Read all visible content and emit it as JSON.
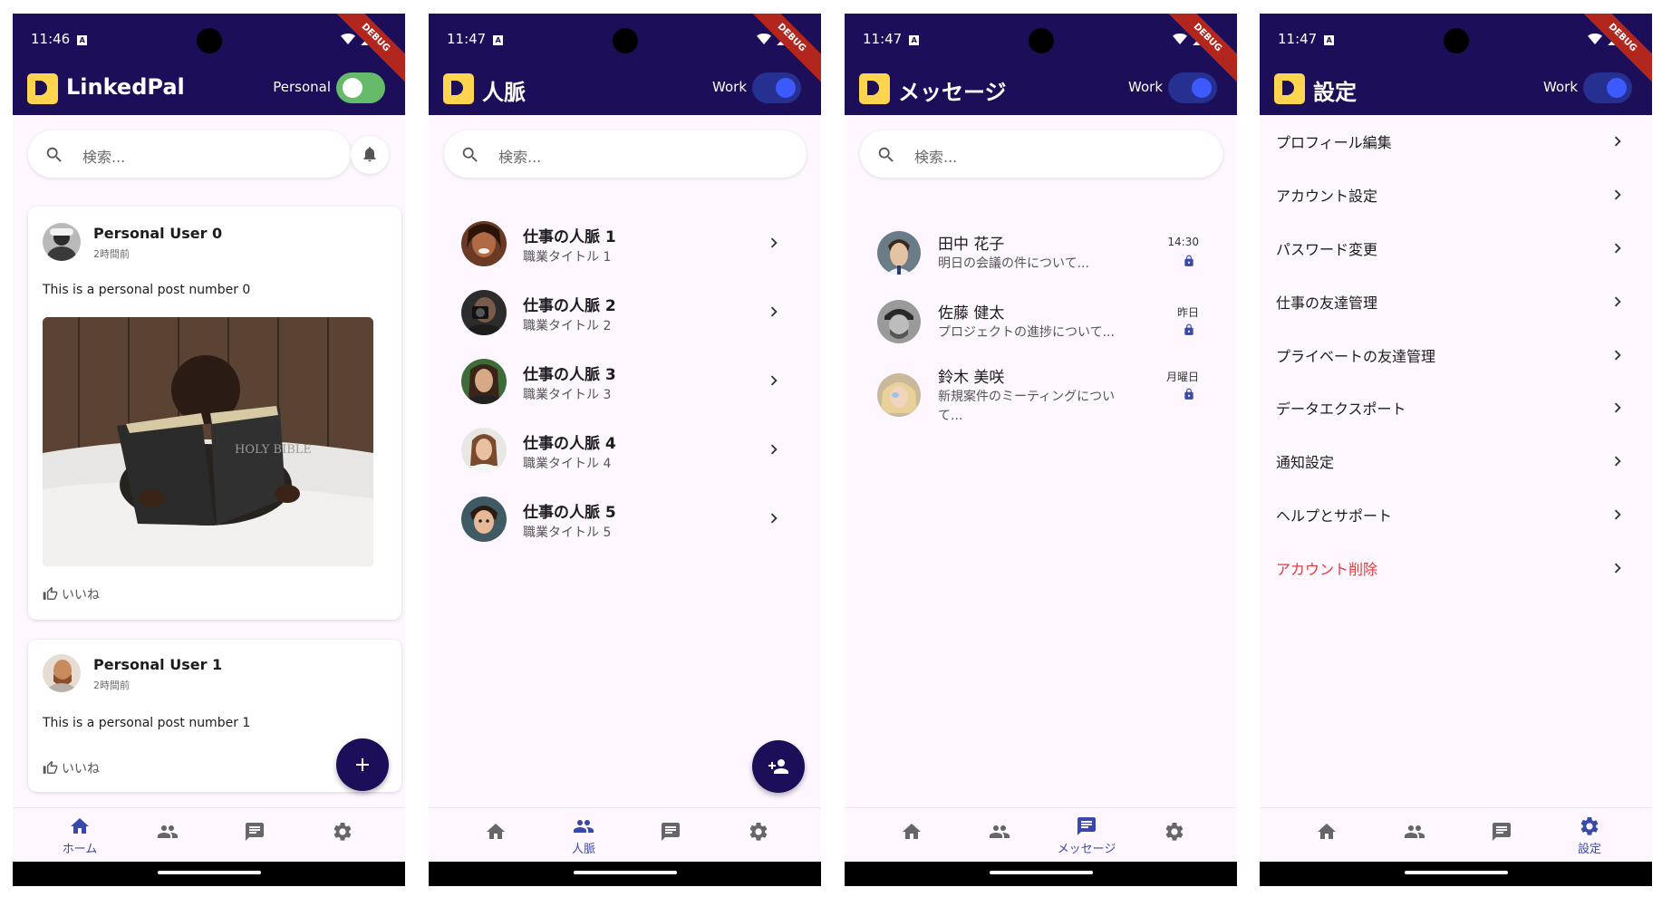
{
  "screens": [
    {
      "status_time": "11:46",
      "title": "LinkedPal",
      "mode": "Personal",
      "search_placeholder": "検索...",
      "posts": [
        {
          "user": "Personal User 0",
          "time": "2時間前",
          "text": "This is a personal post number 0",
          "like": "いいね"
        },
        {
          "user": "Personal User 1",
          "time": "2時間前",
          "text": "This is a personal post number 1",
          "like": "いいね"
        }
      ],
      "photo_caption": "HOLY BIBLE",
      "nav_active_label": "ホーム"
    },
    {
      "status_time": "11:47",
      "title": "人脈",
      "mode": "Work",
      "search_placeholder": "検索...",
      "contacts": [
        {
          "name": "仕事の人脈 1",
          "subtitle": "職業タイトル 1"
        },
        {
          "name": "仕事の人脈 2",
          "subtitle": "職業タイトル 2"
        },
        {
          "name": "仕事の人脈 3",
          "subtitle": "職業タイトル 3"
        },
        {
          "name": "仕事の人脈 4",
          "subtitle": "職業タイトル 4"
        },
        {
          "name": "仕事の人脈 5",
          "subtitle": "職業タイトル 5"
        }
      ],
      "nav_active_label": "人脈"
    },
    {
      "status_time": "11:47",
      "title": "メッセージ",
      "mode": "Work",
      "search_placeholder": "検索...",
      "messages": [
        {
          "name": "田中 花子",
          "preview": "明日の会議の件について...",
          "time": "14:30"
        },
        {
          "name": "佐藤 健太",
          "preview": "プロジェクトの進捗について...",
          "time": "昨日"
        },
        {
          "name": "鈴木 美咲",
          "preview": "新規案件のミーティングについて...",
          "time": "月曜日"
        }
      ],
      "nav_active_label": "メッセージ"
    },
    {
      "status_time": "11:47",
      "title": "設定",
      "mode": "Work",
      "settings": [
        "プロフィール編集",
        "アカウント設定",
        "パスワード変更",
        "仕事の友達管理",
        "プライベートの友達管理",
        "データエクスポート",
        "通知設定",
        "ヘルプとサポート",
        "アカウント削除"
      ],
      "nav_active_label": "設定"
    }
  ],
  "debug_banner": "DEBUG",
  "status_badge": "A",
  "colors": {
    "appbar": "#1c0e58",
    "accent": "#3949ab",
    "logo": "#ffd54f",
    "toggle_personal": "#66bb6a",
    "toggle_work": "#3d5afe",
    "danger": "#e53935"
  }
}
